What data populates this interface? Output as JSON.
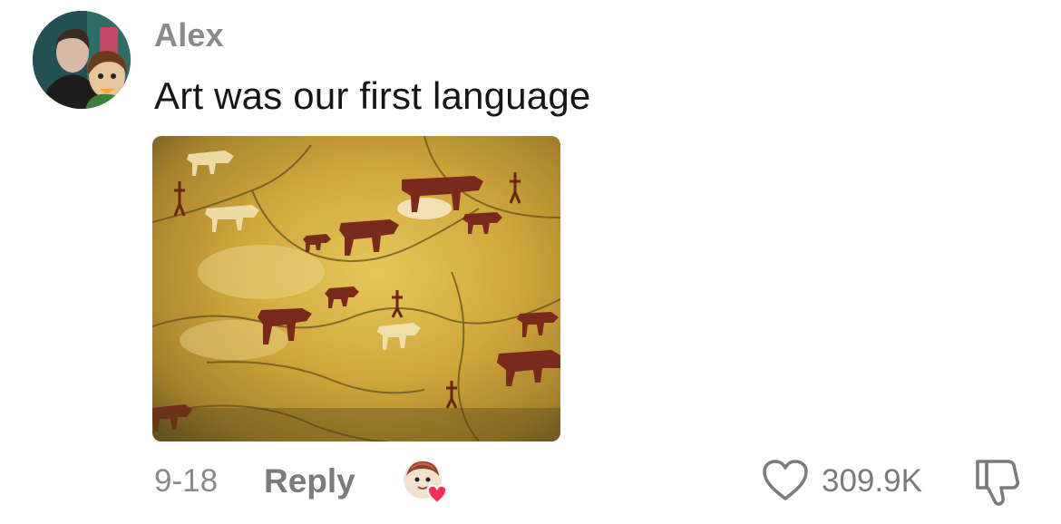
{
  "comment": {
    "author": "Alex",
    "text": "Art was our first language",
    "date": "9-18",
    "reply_label": "Reply",
    "like_count": "309.9K",
    "icons": {
      "avatar": "user-avatar",
      "image": "cave-painting-image",
      "creator_liked": "creator-liked-badge-icon",
      "like": "heart-icon",
      "dislike": "thumbs-down-icon"
    },
    "colors": {
      "username": "#8a8a8a",
      "text": "#161616",
      "meta": "#7b7b7b",
      "heart_badge": "#fe2c55"
    }
  }
}
